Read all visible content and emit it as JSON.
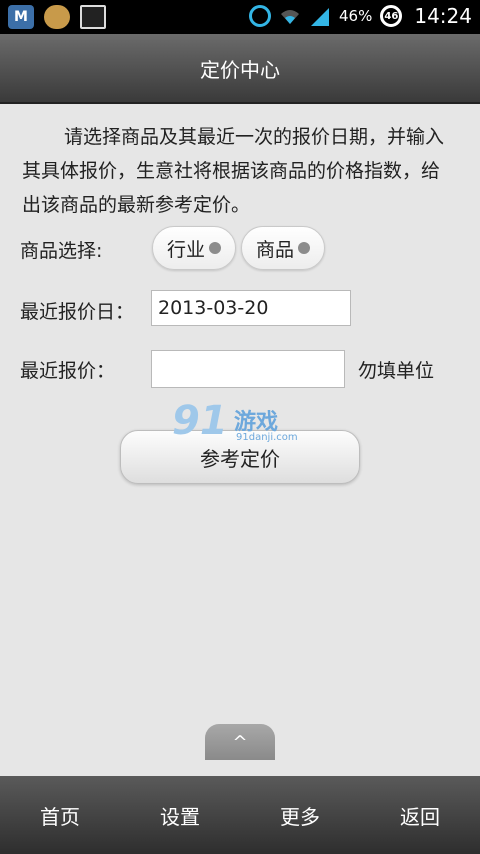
{
  "statusbar": {
    "battery_percent": "46%",
    "battery_badge": "46",
    "time": "14:24",
    "notification_icons": [
      "m-app-icon",
      "burger-icon",
      "image-icon"
    ],
    "status_icons": [
      "alarm-icon",
      "wifi-icon",
      "signal-icon",
      "battery-icon"
    ]
  },
  "header": {
    "title": "定价中心"
  },
  "intro": {
    "text": "请选择商品及其最近一次的报价日期，并输入其具体报价，生意社将根据该商品的价格指数，给出该商品的最新参考定价。"
  },
  "form": {
    "product_label": "商品选择:",
    "industry_select": "行业",
    "product_select": "商品",
    "date_label": "最近报价日：",
    "date_value": "2013-03-20",
    "price_label": "最近报价：",
    "price_value": "",
    "unit_hint": "勿填单位",
    "submit_label": "参考定价"
  },
  "watermark": {
    "num": "91",
    "text": "游戏",
    "url": "91danji.com"
  },
  "scroll_top": {
    "label": "^"
  },
  "nav": {
    "items": [
      "首页",
      "设置",
      "更多",
      "返回"
    ]
  },
  "colors": {
    "status_accent": "#33b5e5",
    "watermark": "#6da8dc"
  }
}
